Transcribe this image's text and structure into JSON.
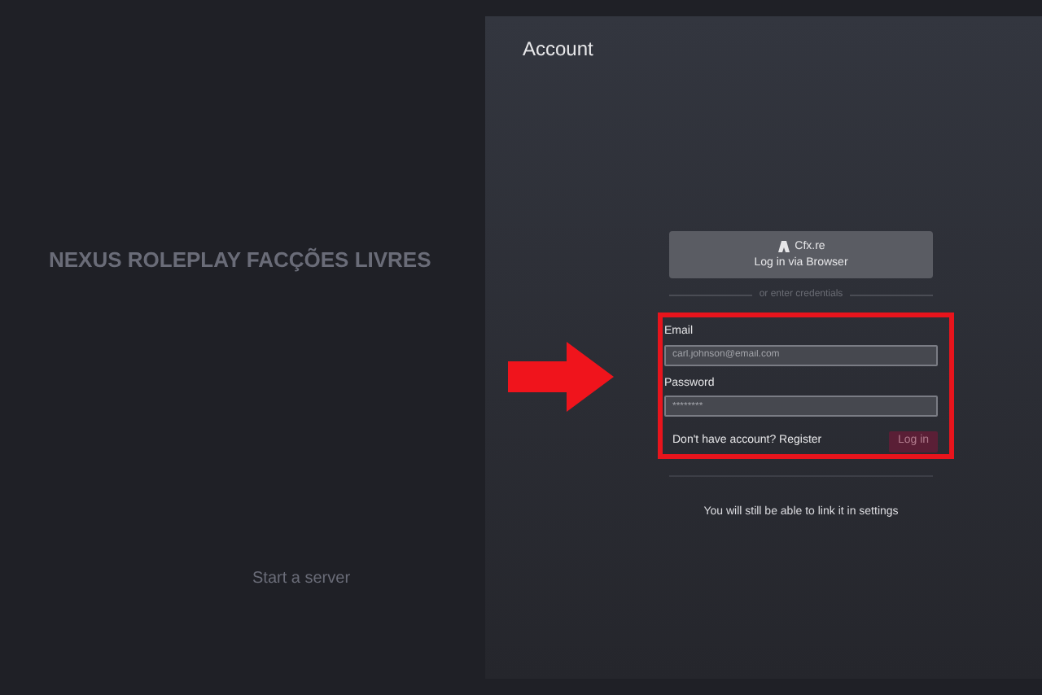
{
  "background": {
    "server_title": "NEXUS ROLEPLAY FACÇÕES LIVRES",
    "start_server": "Start a server"
  },
  "account_panel": {
    "title": "Account",
    "browser_login": {
      "brand": "Cfx.re",
      "label": "Log in via Browser"
    },
    "divider": "or enter credentials",
    "email": {
      "label": "Email",
      "value": "carl.johnson@email.com"
    },
    "password": {
      "label": "Password",
      "value": "********"
    },
    "register_link": "Don't have account? Register",
    "login_button": "Log in",
    "note": "You will still be able to link it in settings"
  }
}
